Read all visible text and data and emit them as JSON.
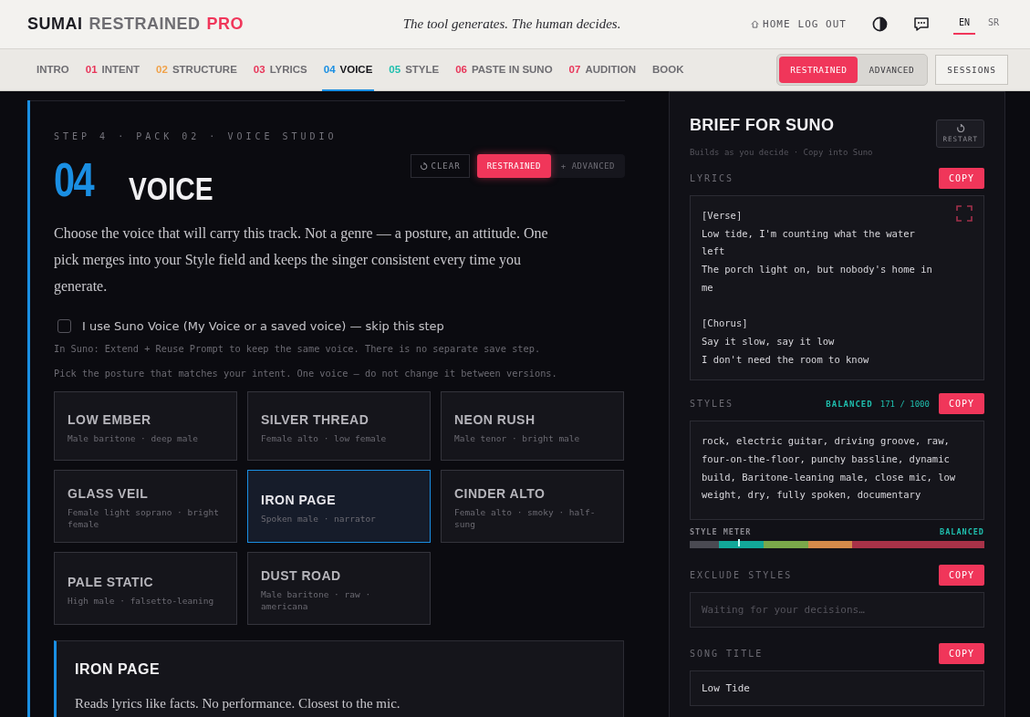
{
  "header": {
    "brand": [
      {
        "text": "SUMAI",
        "color": "#1c1c22"
      },
      {
        "text": "RESTRAINED",
        "color": "#6e6d72"
      },
      {
        "text": "PRO",
        "color": "#f0365a"
      }
    ],
    "tagline": "The tool generates. The human decides.",
    "links": [
      {
        "label": "HOME",
        "kind": "home"
      },
      {
        "label": "LOG OUT",
        "kind": "plain"
      }
    ],
    "languages": [
      {
        "label": "EN",
        "selected": true
      },
      {
        "label": "SR",
        "selected": false
      }
    ]
  },
  "nav": {
    "tabs": [
      {
        "label": "INTRO",
        "selected": false
      },
      {
        "number": "01",
        "label": "INTENT",
        "color": "#e8365a",
        "selected": false
      },
      {
        "number": "02",
        "label": "STRUCTURE",
        "color": "#f0a24a",
        "selected": false
      },
      {
        "number": "03",
        "label": "LYRICS",
        "color": "#e8365a",
        "selected": false
      },
      {
        "number": "04",
        "label": "VOICE",
        "color": "#1a8fe3",
        "selected": true
      },
      {
        "number": "05",
        "label": "STYLE",
        "color": "#1fbfae",
        "selected": false
      },
      {
        "number": "06",
        "label": "PASTE IN SUNO",
        "color": "#e8365a",
        "selected": false
      },
      {
        "number": "07",
        "label": "AUDITION",
        "color": "#e8365a",
        "selected": false
      },
      {
        "label": "BOOK",
        "selected": false
      }
    ],
    "modes": [
      {
        "label": "RESTRAINED",
        "selected": true
      },
      {
        "label": "ADVANCED",
        "selected": false
      }
    ],
    "sessions": "SESSIONS"
  },
  "step": {
    "eyebrow": "STEP 4 · PACK 02 · VOICE STUDIO",
    "number": "04",
    "title": "VOICE",
    "clear": "CLEAR",
    "modes": [
      {
        "label": "RESTRAINED",
        "selected": true
      },
      {
        "label": "+ ADVANCED",
        "selected": false
      }
    ],
    "intro": "Choose the voice that will carry this track. Not a genre — a posture, an attitude. One pick merges into your Style field and keeps the singer consistent every time you generate.",
    "skip": {
      "label": "I use Suno Voice (My Voice or a saved voice) — skip this step",
      "checked": false
    },
    "notes": [
      "In Suno: Extend + Reuse Prompt to keep the same voice. There is no separate save step.",
      "Pick the posture that matches your intent. One voice — do not change it between versions."
    ],
    "voices": [
      {
        "name": "LOW EMBER",
        "desc": "Male baritone · deep male",
        "selected": false
      },
      {
        "name": "SILVER THREAD",
        "desc": "Female alto · low female",
        "selected": false
      },
      {
        "name": "NEON RUSH",
        "desc": "Male tenor · bright male",
        "selected": false
      },
      {
        "name": "GLASS VEIL",
        "desc": "Female light soprano · bright female",
        "selected": false
      },
      {
        "name": "IRON PAGE",
        "desc": "Spoken male · narrator",
        "selected": true
      },
      {
        "name": "CINDER ALTO",
        "desc": "Female alto · smoky · half-sung",
        "selected": false
      },
      {
        "name": "PALE STATIC",
        "desc": "High male · falsetto-leaning",
        "selected": false
      },
      {
        "name": "DUST ROAD",
        "desc": "Male baritone · raw · americana",
        "selected": false
      }
    ],
    "detail": {
      "title": "IRON PAGE",
      "text": "Reads lyrics like facts. No performance. Closest to the mic."
    }
  },
  "brief": {
    "title": "BRIEF FOR SUNO",
    "restart": "RESTART",
    "subtitle": "Builds as you decide · Copy into Suno",
    "lyrics": {
      "label": "LYRICS",
      "copy": "COPY",
      "stanzas": [
        [
          "[Verse]",
          "Low tide, I'm counting what the water left",
          "The porch light on, but nobody's home in me"
        ],
        [
          "[Chorus]",
          "Say it slow, say it low",
          "I don't need the room to know"
        ]
      ]
    },
    "styles": {
      "label": "STYLES",
      "status": "BALANCED",
      "count": "171 / 1000",
      "copy": "COPY",
      "text": "rock, electric guitar, driving groove, raw, four-on-the-floor, punchy bassline, dynamic build, Baritone-leaning male, close mic, low weight, dry, fully spoken, documentary"
    },
    "meter": {
      "label": "STYLE METER",
      "status": "BALANCED",
      "level": 0.17
    },
    "exclude": {
      "label": "EXCLUDE STYLES",
      "copy": "COPY",
      "placeholder": "Waiting for your decisions…"
    },
    "song_title": {
      "label": "SONG TITLE",
      "copy": "COPY",
      "value": "Low Tide"
    }
  }
}
